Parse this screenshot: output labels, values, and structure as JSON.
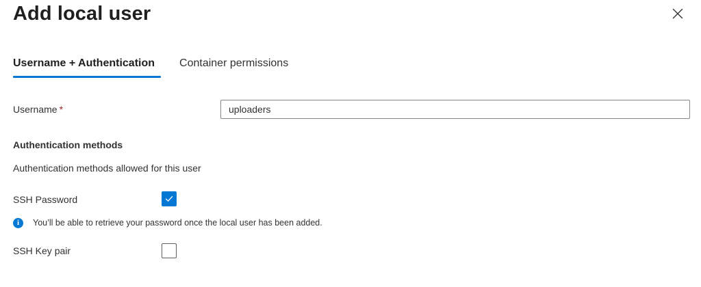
{
  "dialog": {
    "title": "Add local user",
    "close_icon": "close-icon"
  },
  "tabs": [
    {
      "label": "Username + Authentication",
      "active": true
    },
    {
      "label": "Container permissions",
      "active": false
    }
  ],
  "username": {
    "label": "Username",
    "required_marker": "*",
    "value": "uploaders"
  },
  "authentication": {
    "heading": "Authentication methods",
    "description": "Authentication methods allowed for this user",
    "ssh_password": {
      "label": "SSH Password",
      "checked": true
    },
    "info": {
      "icon": "info-icon",
      "glyph": "i",
      "text": "You’ll be able to retrieve your password once the local user has been added."
    },
    "ssh_key_pair": {
      "label": "SSH Key pair",
      "checked": false
    }
  },
  "colors": {
    "accent": "#0078d4",
    "required": "#a4262c",
    "text": "#323130"
  }
}
